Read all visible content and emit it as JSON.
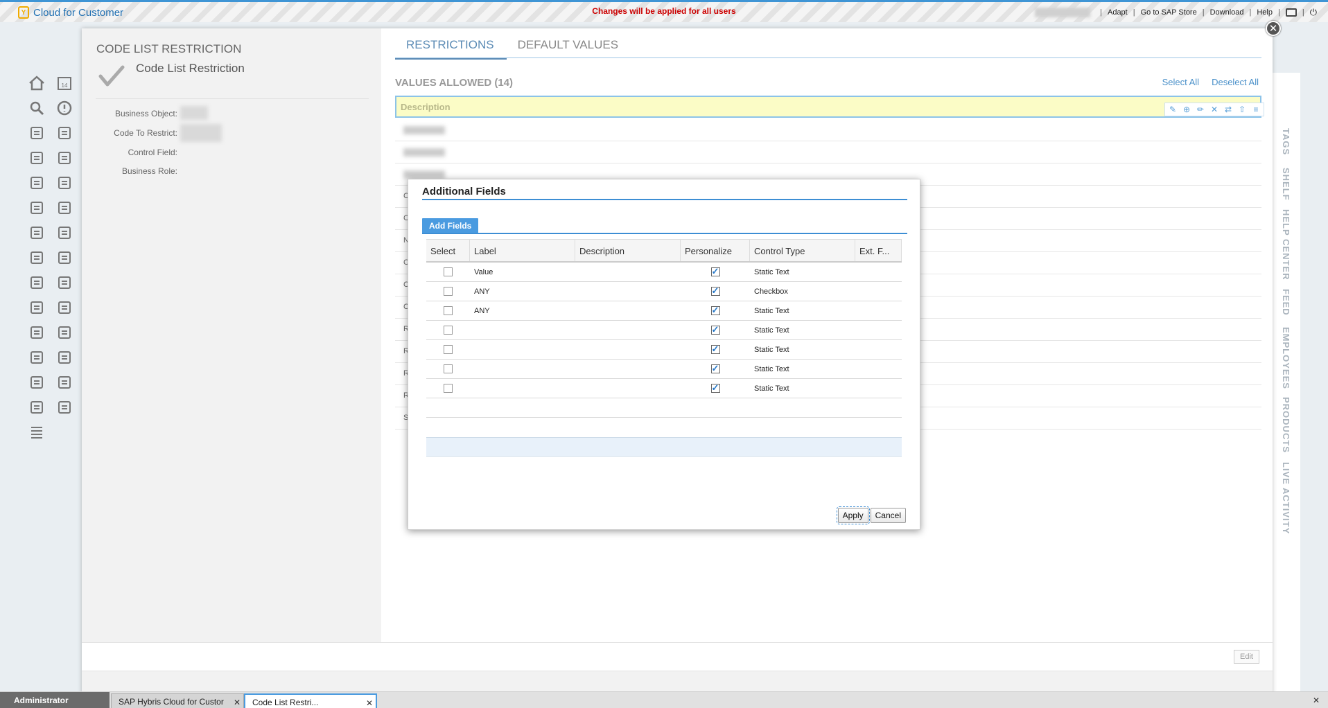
{
  "topbar": {
    "brand": "Cloud for Customer",
    "message": "Changes will be applied for all users",
    "links": [
      "Adapt",
      "Go to SAP Store",
      "Download",
      "Help"
    ]
  },
  "panel": {
    "heading": "CODE LIST RESTRICTION",
    "title": "Code List Restriction",
    "fields": [
      {
        "label": "Business Object:"
      },
      {
        "label": "Code To Restrict:"
      },
      {
        "label": "Control Field:"
      },
      {
        "label": "Business Role:"
      }
    ]
  },
  "tabs": [
    "RESTRICTIONS",
    "DEFAULT VALUES"
  ],
  "values_allowed": {
    "title": "VALUES ALLOWED (14)",
    "select_all": "Select All",
    "deselect_all": "Deselect All",
    "column": "Description",
    "row_stubs": [
      "",
      "",
      "",
      "C",
      "C",
      "N",
      "C",
      "C",
      "C",
      "R",
      "R",
      "R",
      "R",
      "S"
    ]
  },
  "dialog": {
    "title": "Additional Fields",
    "tab": "Add Fields",
    "columns": [
      "Select",
      "Label",
      "Description",
      "Personalize",
      "Control Type",
      "Ext. F..."
    ],
    "rows": [
      {
        "label": "Value",
        "description": "",
        "personalize": true,
        "control": "Static Text"
      },
      {
        "label": "ANY",
        "description": "",
        "personalize": true,
        "control": "Checkbox"
      },
      {
        "label": "ANY",
        "description": "",
        "personalize": true,
        "control": "Static Text"
      },
      {
        "label": "",
        "description": "",
        "personalize": true,
        "control": "Static Text"
      },
      {
        "label": "",
        "description": "",
        "personalize": true,
        "control": "Static Text"
      },
      {
        "label": "",
        "description": "",
        "personalize": true,
        "control": "Static Text"
      },
      {
        "label": "",
        "description": "",
        "personalize": true,
        "control": "Static Text"
      }
    ],
    "apply": "Apply",
    "cancel": "Cancel"
  },
  "footer": {
    "edit": "Edit"
  },
  "side_tabs": [
    "TAGS",
    "SHELF",
    "HELP CENTER",
    "FEED",
    "EMPLOYEES",
    "PRODUCTS",
    "LIVE ACTIVITY"
  ],
  "taskbar": {
    "user": "Administrator",
    "tabs": [
      "SAP Hybris Cloud for Custor",
      "Code List Restri..."
    ]
  },
  "nav_icons": [
    "home-icon",
    "calendar-icon",
    "search-icon",
    "alert-icon",
    "hierarchy-icon",
    "org-chart-icon",
    "box-icon",
    "download-icon",
    "person-icon",
    "contacts-icon",
    "mail-icon",
    "checklist-icon",
    "money-in-icon",
    "dollar-icon",
    "user-settings-icon",
    "edit-doc-icon",
    "grid-clock-icon",
    "time-doc-icon",
    "chat-list-icon",
    "notebook-icon",
    "invoice-icon",
    "globe-icon",
    "map-pin-icon",
    "calendar-2-icon",
    "calculator-icon",
    "clipboard-icon",
    "cube-icon",
    "report-icon",
    "list-icon"
  ]
}
